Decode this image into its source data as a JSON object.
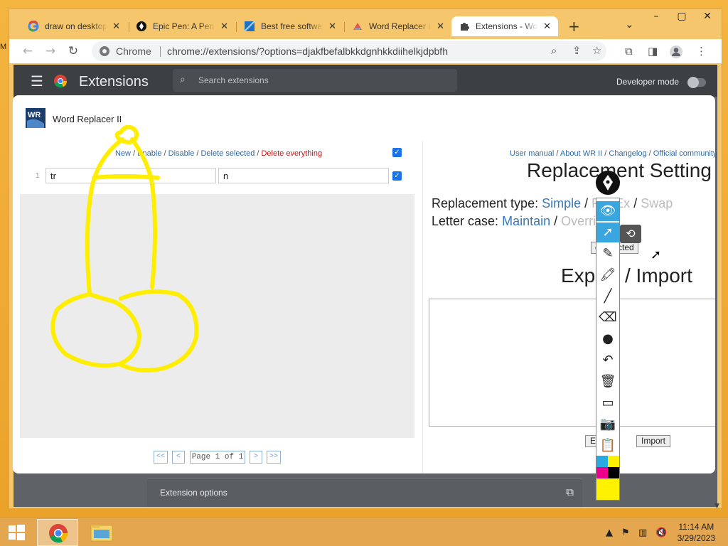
{
  "browser": {
    "tabs": [
      {
        "title": "draw on desktop",
        "icon": "google-icon"
      },
      {
        "title": "Epic Pen: A Pen",
        "icon": "epic-pen-icon"
      },
      {
        "title": "Best free softwa",
        "icon": "software-icon"
      },
      {
        "title": "Word Replacer I",
        "icon": "word-replacer-icon"
      },
      {
        "title": "Extensions - Wo",
        "icon": "puzzle-icon",
        "active": true
      }
    ],
    "new_tab_label": "+",
    "window_controls": {
      "minimize": "–",
      "maximize": "▢",
      "close": "✕",
      "tab_search": "⌄"
    },
    "omnibox": {
      "site_label": "Chrome",
      "url": "chrome://extensions/?options=djakfbefalbkkdgnhkkdiihelkjdpbfh"
    }
  },
  "extensions_page": {
    "title": "Extensions",
    "search_placeholder": "Search extensions",
    "developer_mode_label": "Developer mode",
    "developer_mode_on": false,
    "extension_options_label": "Extension options"
  },
  "dialog": {
    "title": "Word Replacer II",
    "logo_text": "WR",
    "left": {
      "actions": [
        {
          "label": "New",
          "style": "link"
        },
        {
          "label": "Enable",
          "style": "link"
        },
        {
          "label": "Disable",
          "style": "link"
        },
        {
          "label": "Delete selected",
          "style": "link"
        },
        {
          "label": "Delete everything",
          "style": "danger"
        }
      ],
      "separator": " / ",
      "select_all_checked": true,
      "rows": [
        {
          "number": "1",
          "find": "tr",
          "replace": "n",
          "checked": true
        }
      ],
      "pager": {
        "first": "<<",
        "prev": "<",
        "label": "Page 1 of 1",
        "next": ">",
        "last": ">>"
      }
    },
    "right": {
      "links": [
        "User manual",
        "About WR II",
        "Changelog",
        "Official community"
      ],
      "settings_heading": "Replacement Setting",
      "replacement_type_label": "Replacement type:",
      "replacement_types": [
        "Simple",
        "RegEx",
        "Swap"
      ],
      "replacement_type_selected": "Simple",
      "letter_case_label": "Letter case:",
      "letter_cases": [
        "Maintain",
        "Override"
      ],
      "letter_case_selected": "Maintain",
      "apply_label": "Apply to selected",
      "apply_visible": "o selected",
      "export_heading": "Export / Import",
      "export_heading_visible_left": "Exp",
      "export_heading_visible_right": "/ Import",
      "export_button": "Export",
      "export_button_visible": "E",
      "import_button": "Import"
    }
  },
  "epic_pen": {
    "tools": [
      {
        "name": "visibility-icon",
        "glyph": "👁",
        "selected": true
      },
      {
        "name": "cursor-icon",
        "glyph": "➚",
        "selected": true
      },
      {
        "name": "pen-icon",
        "glyph": "✎"
      },
      {
        "name": "highlighter-icon",
        "glyph": "🖍"
      },
      {
        "name": "line-icon",
        "glyph": "╱"
      },
      {
        "name": "eraser-icon",
        "glyph": "⌫"
      },
      {
        "name": "brush-size-icon",
        "glyph": "●"
      },
      {
        "name": "undo-icon",
        "glyph": "↶"
      },
      {
        "name": "clear-icon",
        "glyph": "🗑"
      },
      {
        "name": "whiteboard-icon",
        "glyph": "▭"
      },
      {
        "name": "screenshot-icon",
        "glyph": "📷"
      },
      {
        "name": "clipboard-icon",
        "glyph": "📋"
      }
    ],
    "palette": [
      "#29abe2",
      "#fff200",
      "#ec008c",
      "#000000",
      "#fff200"
    ]
  },
  "annotation": {
    "color": "#ffee00"
  },
  "taskbar": {
    "apps": [
      {
        "name": "chrome-taskbar-icon",
        "active": true
      },
      {
        "name": "file-explorer-taskbar-icon",
        "active": false
      }
    ],
    "time": "11:14 AM",
    "date": "3/29/2023"
  },
  "colors": {
    "accent_blue": "#1a73e8",
    "link_blue": "#2e6aa8",
    "danger_red": "#cc1111",
    "desktop_orange": "#f0a830"
  }
}
